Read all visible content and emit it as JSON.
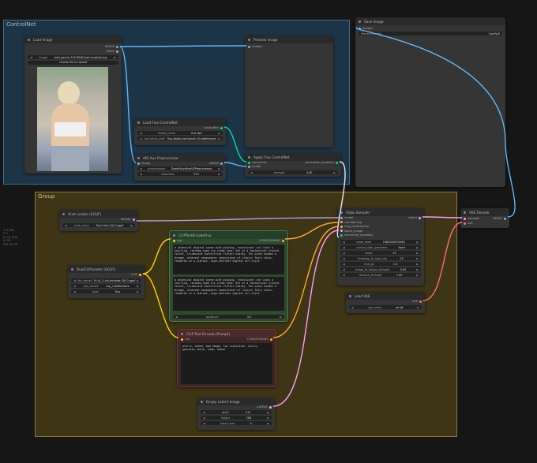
{
  "groups": {
    "controlnet": "ControlNet",
    "group": "Group"
  },
  "side_info": [
    "T: 0.00s",
    "I: 0",
    "N: 24 [24]",
    "V: 28",
    "FPS:30.30"
  ],
  "nodes": {
    "load_image": {
      "title": "Load Image",
      "out1": "IMAGE",
      "out2": "MASK",
      "image_label": "image",
      "image_value": "josh-paccia-7Uk7N0tCaaA-unsplash.jpg",
      "upload": "choose file to upload"
    },
    "preview_image": {
      "title": "Preview Image",
      "in1": "images"
    },
    "save_image": {
      "title": "Save Image",
      "in1": "images",
      "prefix_label": "filename_prefix",
      "prefix_value": "ComfyUI"
    },
    "load_flux_controlnet": {
      "title": "Load Flux ControlNet",
      "out1": "ControlNet",
      "w1_label": "model_name",
      "w1_value": "flux-dev",
      "w2_label": "controlnet_path",
      "w2_value": "flux-depth-controlnet-v3.safetensors"
    },
    "aio_preprocessor": {
      "title": "AIO Aux Preprocessor",
      "in1": "image",
      "out1": "IMAGE",
      "w1_label": "preprocessor",
      "w1_value": "DepthAnythingV2Preprocessor",
      "w2_label": "resolution",
      "w2_value": "512"
    },
    "apply_flux_controlnet": {
      "title": "Apply Flux ControlNet",
      "in1": "controlnet",
      "in2": "image",
      "out1": "controlnet_condition",
      "w1_label": "strength",
      "w1_value": "0.60"
    },
    "unet_loader": {
      "title": "Unet Loader (GGUF)",
      "out1": "MODEL",
      "w1_label": "unet_name",
      "w1_value": "flux1-dev-Q4_0.gguf"
    },
    "dual_clip": {
      "title": "DualCLIPLoader (GGUF)",
      "out1": "CLIP",
      "w1_label": "clip_name1",
      "w1_value": "t5-v1_1-xxl-encoder-Q8_0.gguf",
      "w2_label": "clip_name2",
      "w2_value": "clip_l.safetensors",
      "w3_label": "type",
      "w3_value": "flux"
    },
    "clip_flux": {
      "title": "CLIPTextEncodeFlux",
      "in1": "clip",
      "out1": "CONDITIONING",
      "text1": "a whimsical digital scene with glowing, translucent ice links a swirling, rainbow-hued ice cream cone. Set in a fantastical crystal forest, iridescent butterflies flutter nearby. The scene exudes a dreamy, ethereal atmosphere reminiscent of classic fairy tales, rendered in a vibrant, high-contrast digital art style.",
      "text2": "a whimsical digital scene with glowing, translucent ice links a swirling, rainbow-hued ice cream cone. Set in a fantastical crystal forest, iridescent butterflies flutter nearby. The scene exudes a dreamy, ethereal atmosphere reminiscent of classic fairy tales, rendered in a vibrant, high-contrast digital art style.",
      "w1_label": "guidance",
      "w1_value": "3.5"
    },
    "clip_prompt": {
      "title": "CLIP Text Encode (Prompt)",
      "in1": "clip",
      "out1": "CONDITIONING",
      "text": "blurry, bokeh, bad image, low resolution, blurry gaussian noise, nude, naked"
    },
    "empty_latent": {
      "title": "Empty Latent Image",
      "out1": "LATENT",
      "w1_label": "width",
      "w1_value": "512",
      "w2_label": "height",
      "w2_value": "768",
      "w3_label": "batch_size",
      "w3_value": "4"
    },
    "xlabs_sampler": {
      "title": "Xlabs Sampler",
      "out1": "latent",
      "inputs": [
        "model",
        "conditioning",
        "neg_conditioning",
        "latent_image",
        "controlnet_condition"
      ],
      "widgets": [
        {
          "label": "noise_seed",
          "value": "1985200572063"
        },
        {
          "label": "control_after_generate",
          "value": "fixed"
        },
        {
          "label": "steps",
          "value": "25"
        },
        {
          "label": "timestep_to_start_cfg",
          "value": "25"
        },
        {
          "label": "true_gs",
          "value": "1.0"
        },
        {
          "label": "image_to_image_strength",
          "value": "0.00"
        },
        {
          "label": "denoise_strength",
          "value": "1.00"
        }
      ]
    },
    "vae_decode": {
      "title": "VAE Decode",
      "in1": "samples",
      "in2": "vae",
      "out1": "IMAGE"
    },
    "load_vae": {
      "title": "Load VAE",
      "out1": "VAE",
      "w1_label": "vae_name",
      "w1_value": "ae.sft"
    }
  },
  "colors": {
    "controlnet_group_bg": "#1d3a52",
    "controlnet_group_border": "#3f6d8f",
    "group_bg": "#4a3f1d",
    "group_border": "#8f7a34",
    "link_image": "#64b5f6",
    "link_conditioning": "#ffa931",
    "link_clip": "#ffd500",
    "link_latent": "#ff9cf9",
    "link_model": "#b39ddb",
    "link_vae": "#ff6e6e",
    "link_control": "#00d7a6"
  }
}
